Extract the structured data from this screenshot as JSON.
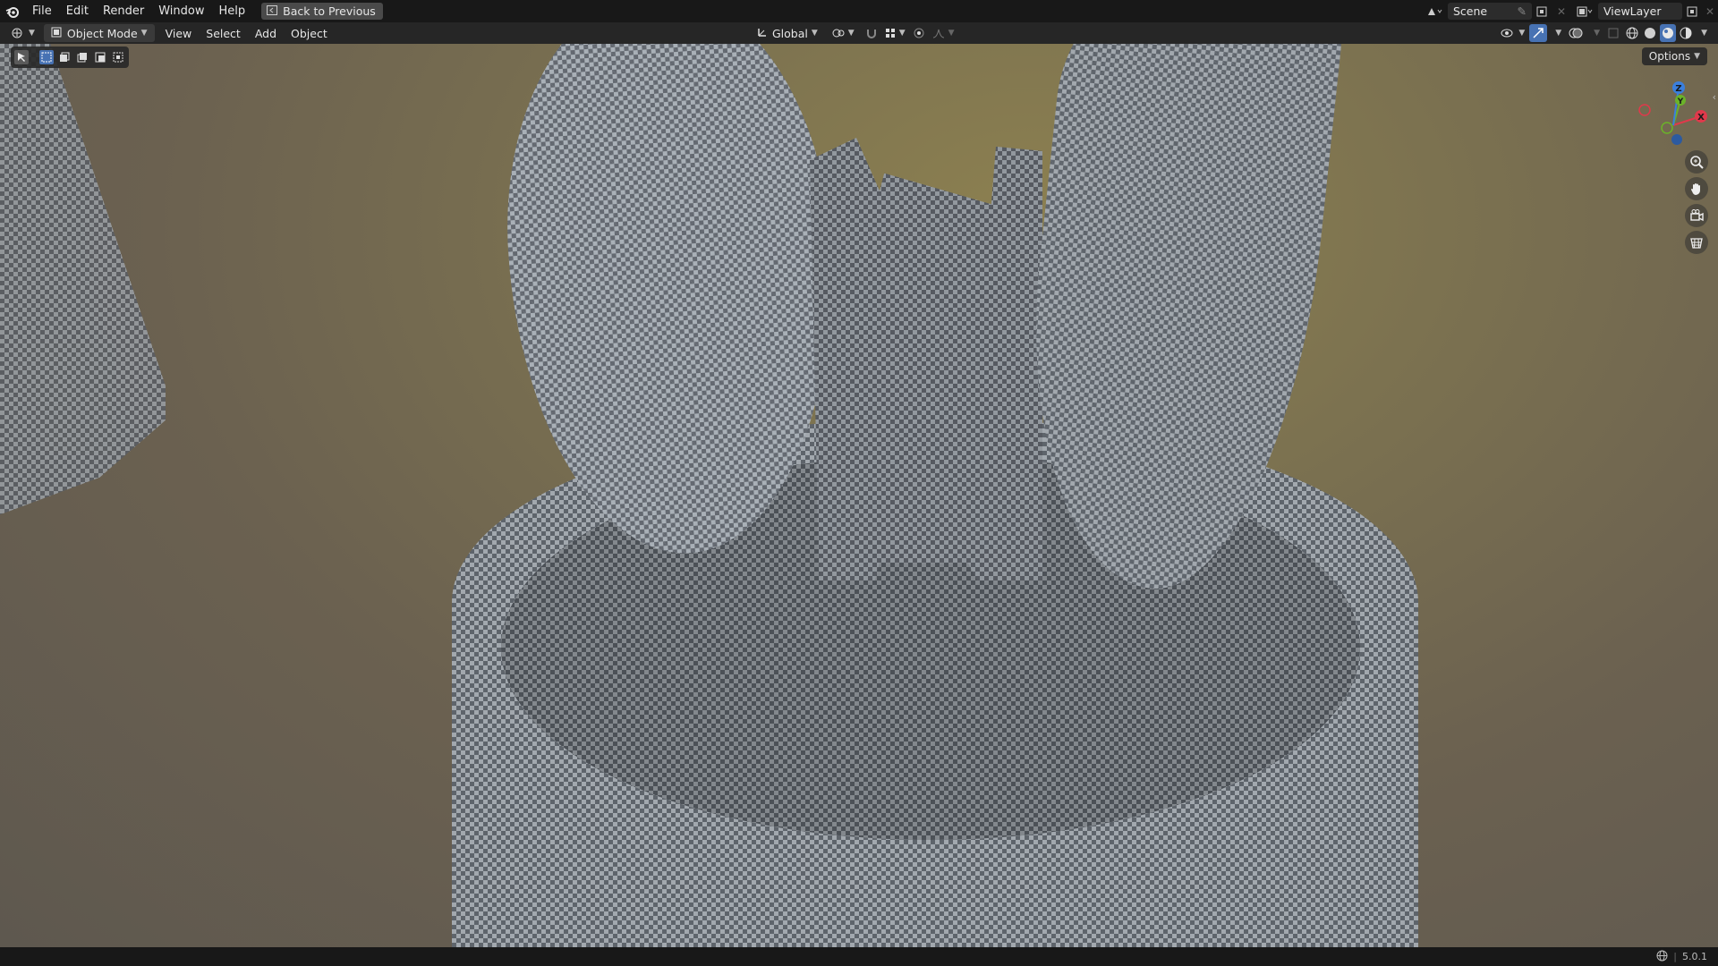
{
  "topbar": {
    "menus": [
      "File",
      "Edit",
      "Render",
      "Window",
      "Help"
    ],
    "back_label": "Back to Previous",
    "scene_name": "Scene",
    "view_layer": "ViewLayer"
  },
  "header": {
    "mode": "Object Mode",
    "menus": [
      "View",
      "Select",
      "Add",
      "Object"
    ],
    "transform_orientation": "Global"
  },
  "viewport": {
    "options_label": "Options",
    "gizmo_axes": [
      "X",
      "Y",
      "Z"
    ],
    "nav_icons": [
      "zoom-icon",
      "pan-hand-icon",
      "camera-icon",
      "ortho-grid-icon"
    ]
  },
  "status": {
    "version": "5.0.1"
  },
  "colors": {
    "axis_x": "#e0394b",
    "axis_y": "#6bb329",
    "axis_z": "#3b7fdd",
    "accent": "#4772b3"
  }
}
